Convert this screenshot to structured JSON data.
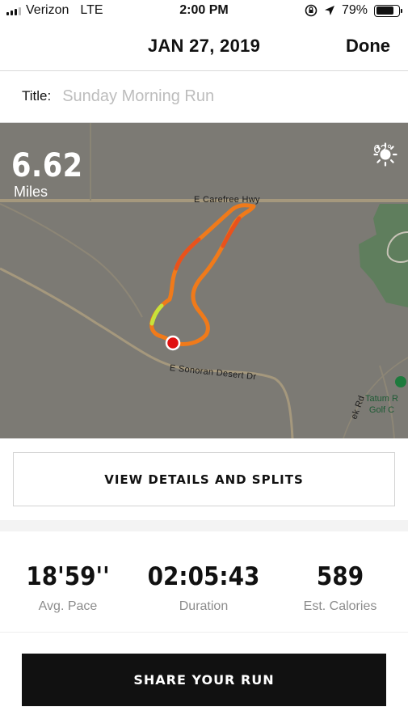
{
  "status_bar": {
    "carrier": "Verizon",
    "network": "LTE",
    "time": "2:00 PM",
    "battery": "79%",
    "battery_level": 0.79
  },
  "nav": {
    "title": "JAN 27, 2019",
    "done_label": "Done"
  },
  "title_field": {
    "label": "Title:",
    "placeholder": "Sunday Morning Run",
    "value": ""
  },
  "map": {
    "distance": "6.62",
    "distance_unit": "Miles",
    "temperature": "62°",
    "weather_icon": "sun-icon",
    "labels": {
      "road_north": "E Carefree Hwy",
      "road_south": "E Sonoran Desert Dr",
      "road_creek": "ek Rd",
      "place": "Tatum R\nGolf C"
    },
    "colors": {
      "map_bg": "#7c7a74",
      "route_main": "#f07a1a",
      "route_hot": "#e9521c",
      "route_cool": "#c8e23a",
      "start_marker": "#e01010"
    }
  },
  "details_button": "VIEW DETAILS AND SPLITS",
  "stats": [
    {
      "value": "18'59''",
      "label": "Avg. Pace"
    },
    {
      "value": "02:05:43",
      "label": "Duration"
    },
    {
      "value": "589",
      "label": "Est. Calories"
    }
  ],
  "share_button": "SHARE YOUR RUN"
}
